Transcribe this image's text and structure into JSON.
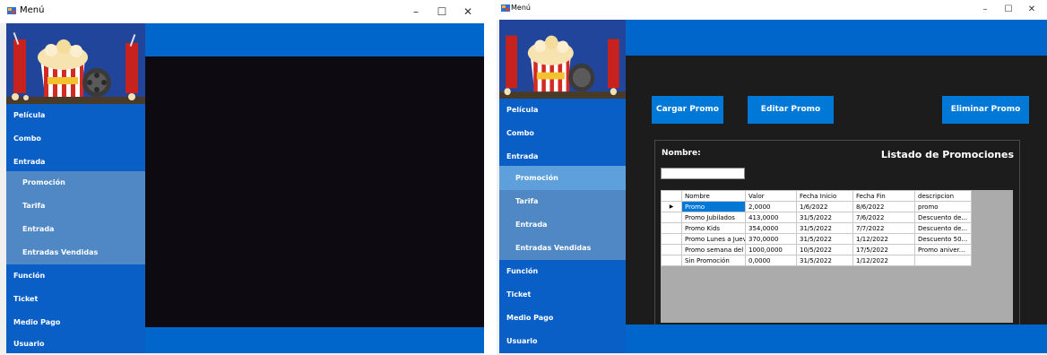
{
  "window_title": "Menú",
  "window_controls": {
    "minimize": "–",
    "maximize": "☐",
    "close": "✕"
  },
  "menu": {
    "pelicula": "Película",
    "combo": "Combo",
    "entrada": "Entrada",
    "sub": [
      "Promoción",
      "Tarifa",
      "Entrada",
      "Entradas Vendidas"
    ],
    "funcion": "Función",
    "ticket": "Ticket",
    "medio_pago": "Medio Pago",
    "usuario": "Usuario"
  },
  "promo_form": {
    "cargar": "Cargar Promo",
    "editar": "Editar Promo",
    "eliminar": "Eliminar Promo",
    "nombre_label": "Nombre:",
    "nombre_value": "",
    "listado_title": "Listado de Promociones",
    "columns": [
      "Nombre",
      "Valor",
      "Fecha Inicio",
      "Fecha Fin",
      "descripcion"
    ],
    "rows": [
      [
        "Promo",
        "2,0000",
        "1/6/2022",
        "8/6/2022",
        "promo"
      ],
      [
        "Promo Jubilados",
        "413,0000",
        "31/5/2022",
        "7/6/2022",
        "Descuento de..."
      ],
      [
        "Promo Kids",
        "354,0000",
        "31/5/2022",
        "7/7/2022",
        "Descuento de..."
      ],
      [
        "Promo Lunes a Jueves",
        "370,0000",
        "31/5/2022",
        "1/12/2022",
        "Descuento 50..."
      ],
      [
        "Promo semana del c...",
        "1000,0000",
        "10/5/2022",
        "17/5/2022",
        "Promo aniver..."
      ],
      [
        "Sin Promoción",
        "0,0000",
        "31/5/2022",
        "1/12/2022",
        ""
      ]
    ]
  },
  "colors": {
    "sidebar": "#0a5fc7",
    "submenu": "#4f88c4",
    "selected": "#5ea0dc",
    "banner": "#0066cc",
    "dark_left": "#0d0a12",
    "dark_right": "#1c1c1c",
    "button": "#0078d7"
  }
}
